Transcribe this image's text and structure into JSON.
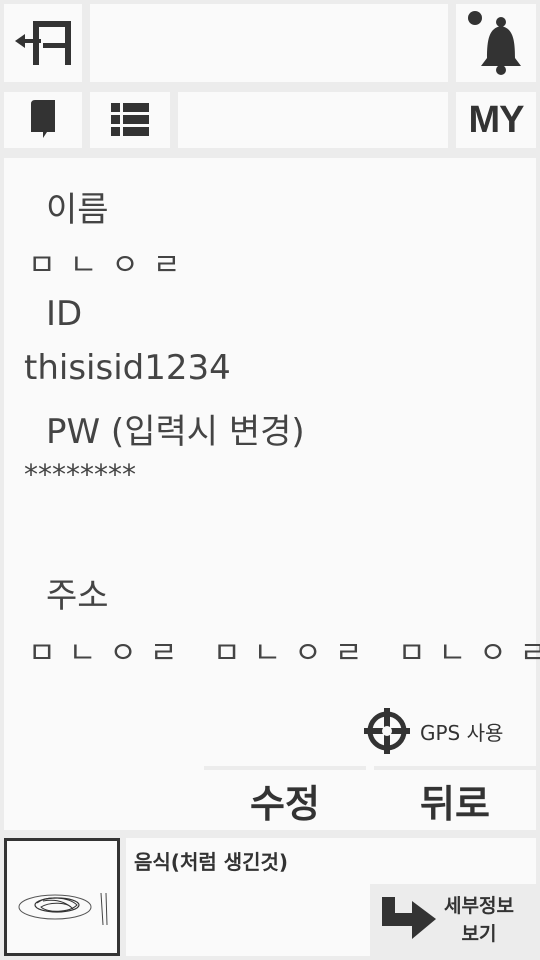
{
  "header": {
    "logout_icon": "logout-icon",
    "bell_icon": "bell-icon",
    "book_icon": "book-icon",
    "list_icon": "list-icon",
    "my_label": "MY"
  },
  "form": {
    "name_label": "이름",
    "name_value": "ㅁㄴㅇㄹ",
    "id_label": "ID",
    "id_value": "thisisid1234",
    "pw_label": "PW (입력시 변경)",
    "pw_value": "********",
    "address_label": "주소",
    "address_value": "ㅁㄴㅇㄹ ㅁㄴㅇㄹ ㅁㄴㅇㄹ"
  },
  "actions": {
    "gps_label": "GPS 사용",
    "edit_label": "수정",
    "back_label": "뒤로"
  },
  "card": {
    "title": "음식(처럼 생긴것)",
    "detail_line1": "세부정보",
    "detail_line2": "보기"
  }
}
